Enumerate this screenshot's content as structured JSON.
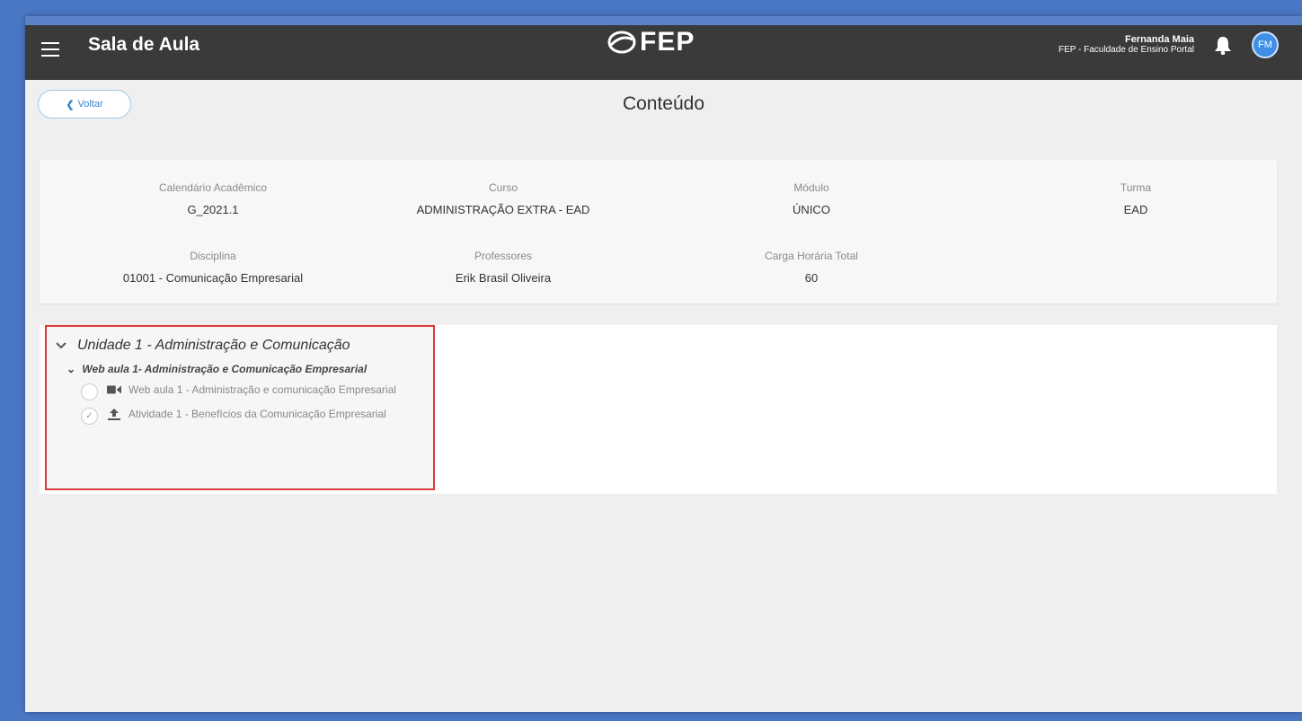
{
  "header": {
    "title": "Sala de Aula",
    "logo_text": "FEP",
    "user_name": "Fernanda Maia",
    "institution": "FEP - Faculdade de Ensino Portal",
    "avatar_initials": "FM"
  },
  "back_label": "Voltar",
  "page_title": "Conteúdo",
  "info": {
    "calendario_label": "Calendário Acadêmico",
    "calendario_value": "G_2021.1",
    "curso_label": "Curso",
    "curso_value": "ADMINISTRAÇÃO EXTRA - EAD",
    "modulo_label": "Módulo",
    "modulo_value": "ÚNICO",
    "turma_label": "Turma",
    "turma_value": "EAD",
    "disciplina_label": "Disciplina",
    "disciplina_value": "01001 - Comunicação Empresarial",
    "professores_label": "Professores",
    "professores_value": "Erik Brasil Oliveira",
    "carga_label": "Carga Horária Total",
    "carga_value": "60"
  },
  "tree": {
    "unit_title": "Unidade 1 - Administração e Comunicação",
    "lesson_title": "Web aula 1- Administração e Comunicação Empresarial",
    "items": [
      {
        "label": "Web aula 1 - Administração e comunicação Empresarial",
        "icon": "video-icon",
        "done": false
      },
      {
        "label": "Atividade 1 - Benefícios da Comunicação Empresarial",
        "icon": "upload-icon",
        "done": true
      }
    ]
  },
  "colors": {
    "topbar": "#3a3a3a",
    "accent": "#3f8fe6",
    "highlight_border": "#d83a3a",
    "outer_frame": "#4a77c4"
  }
}
